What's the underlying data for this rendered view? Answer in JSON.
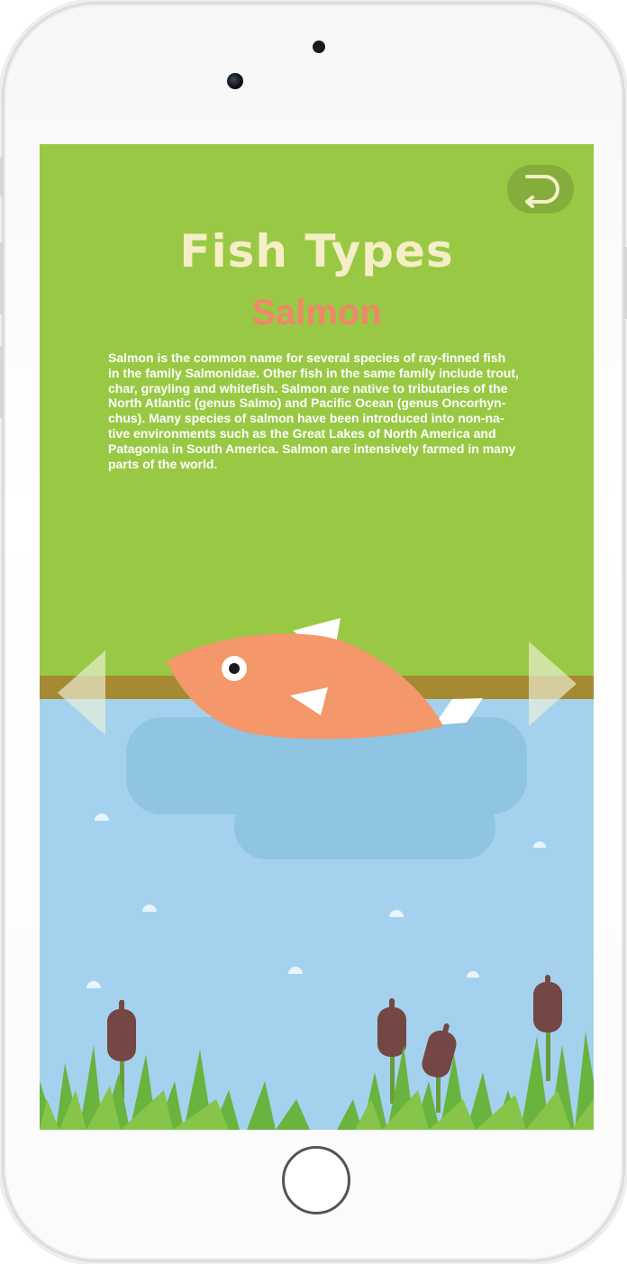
{
  "screen": {
    "title": "Fish Types",
    "fish_name": "Salmon",
    "description_lines": [
      "Salmon is the common name for several species of ray-finned fish",
      "in the family Salmonidae. Other fish in the same family include trout,",
      "char, grayling and whitefish. Salmon are native to tributaries of the",
      "North Atlantic (genus Salmo) and Pacific Ocean (genus Oncorhyn-",
      "chus). Many species of salmon have been introduced into non-na-",
      "tive environments such as the Great Lakes of North America and",
      "Patagonia in South America. Salmon are intensively farmed in many",
      "parts of the world."
    ]
  },
  "icons": {
    "back": "back-arrow-icon",
    "prev": "left-arrow-icon",
    "next": "right-arrow-icon"
  },
  "colors": {
    "grass_background": "#99c944",
    "title": "#f6eec7",
    "fish_name": "#f0866a",
    "fish_body": "#f4976a",
    "water": "#a4d2ee",
    "ground": "#a68a33",
    "cattail": "#744644"
  }
}
